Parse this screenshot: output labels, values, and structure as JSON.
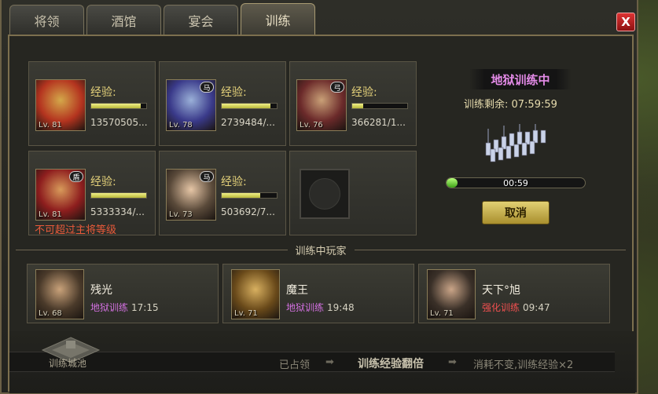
{
  "tabs": [
    "将领",
    "酒馆",
    "宴会",
    "训练"
  ],
  "active_tab": 3,
  "close_label": "X",
  "generals": [
    {
      "lv": "Lv. 81",
      "exp_label": "经验:",
      "exp_value": "13570505...",
      "exp_fraction": 0.9,
      "badge": "",
      "colors": [
        "#b4341f",
        "#d4a84a"
      ]
    },
    {
      "lv": "Lv. 78",
      "exp_label": "经验:",
      "exp_value": "2739484/...",
      "exp_fraction": 0.88,
      "badge": "马",
      "colors": [
        "#3a3a8a",
        "#9ab0d8"
      ]
    },
    {
      "lv": "Lv. 76",
      "exp_label": "经验:",
      "exp_value": "366281/1...",
      "exp_fraction": 0.2,
      "badge": "弓",
      "colors": [
        "#6b2a2a",
        "#c9a077"
      ]
    },
    {
      "lv": "Lv. 81",
      "exp_label": "经验:",
      "exp_value": "5333334/...",
      "exp_fraction": 1.0,
      "badge": "盾",
      "colors": [
        "#8e1e1e",
        "#d89a5a"
      ]
    },
    {
      "lv": "Lv. 73",
      "exp_label": "经验:",
      "exp_value": "503692/7...",
      "exp_fraction": 0.7,
      "badge": "马",
      "colors": [
        "#5a4a3a",
        "#e6c6a6"
      ]
    }
  ],
  "warning": "不可超过主将等级",
  "training": {
    "mode_title": "地狱训练中",
    "remaining": "训练剩余: 07:59:59",
    "progress_text": "00:59",
    "progress_fraction": 0.04,
    "cancel_label": "取消"
  },
  "players_header": "训练中玩家",
  "players": [
    {
      "name": "残光",
      "mode": "地狱训练",
      "time": "17:15",
      "lv": "Lv. 68",
      "mode_color": "#d270e0",
      "colors": [
        "#4a3a2a",
        "#c9a27a"
      ]
    },
    {
      "name": "魔王",
      "mode": "地狱训练",
      "time": "19:48",
      "lv": "Lv. 71",
      "mode_color": "#d270e0",
      "colors": [
        "#6a4a1a",
        "#d8b060"
      ]
    },
    {
      "name": "天下°旭",
      "mode": "强化训练",
      "time": "09:47",
      "lv": "Lv. 71",
      "mode_color": "#f05050",
      "colors": [
        "#3a3028",
        "#caa588"
      ]
    }
  ],
  "bottom": {
    "city_label": "训练城池",
    "occupied": "已占领",
    "bonus": "训练经验翻倍",
    "effect": "消耗不变,训练经验×2",
    "arrow": "➡"
  }
}
